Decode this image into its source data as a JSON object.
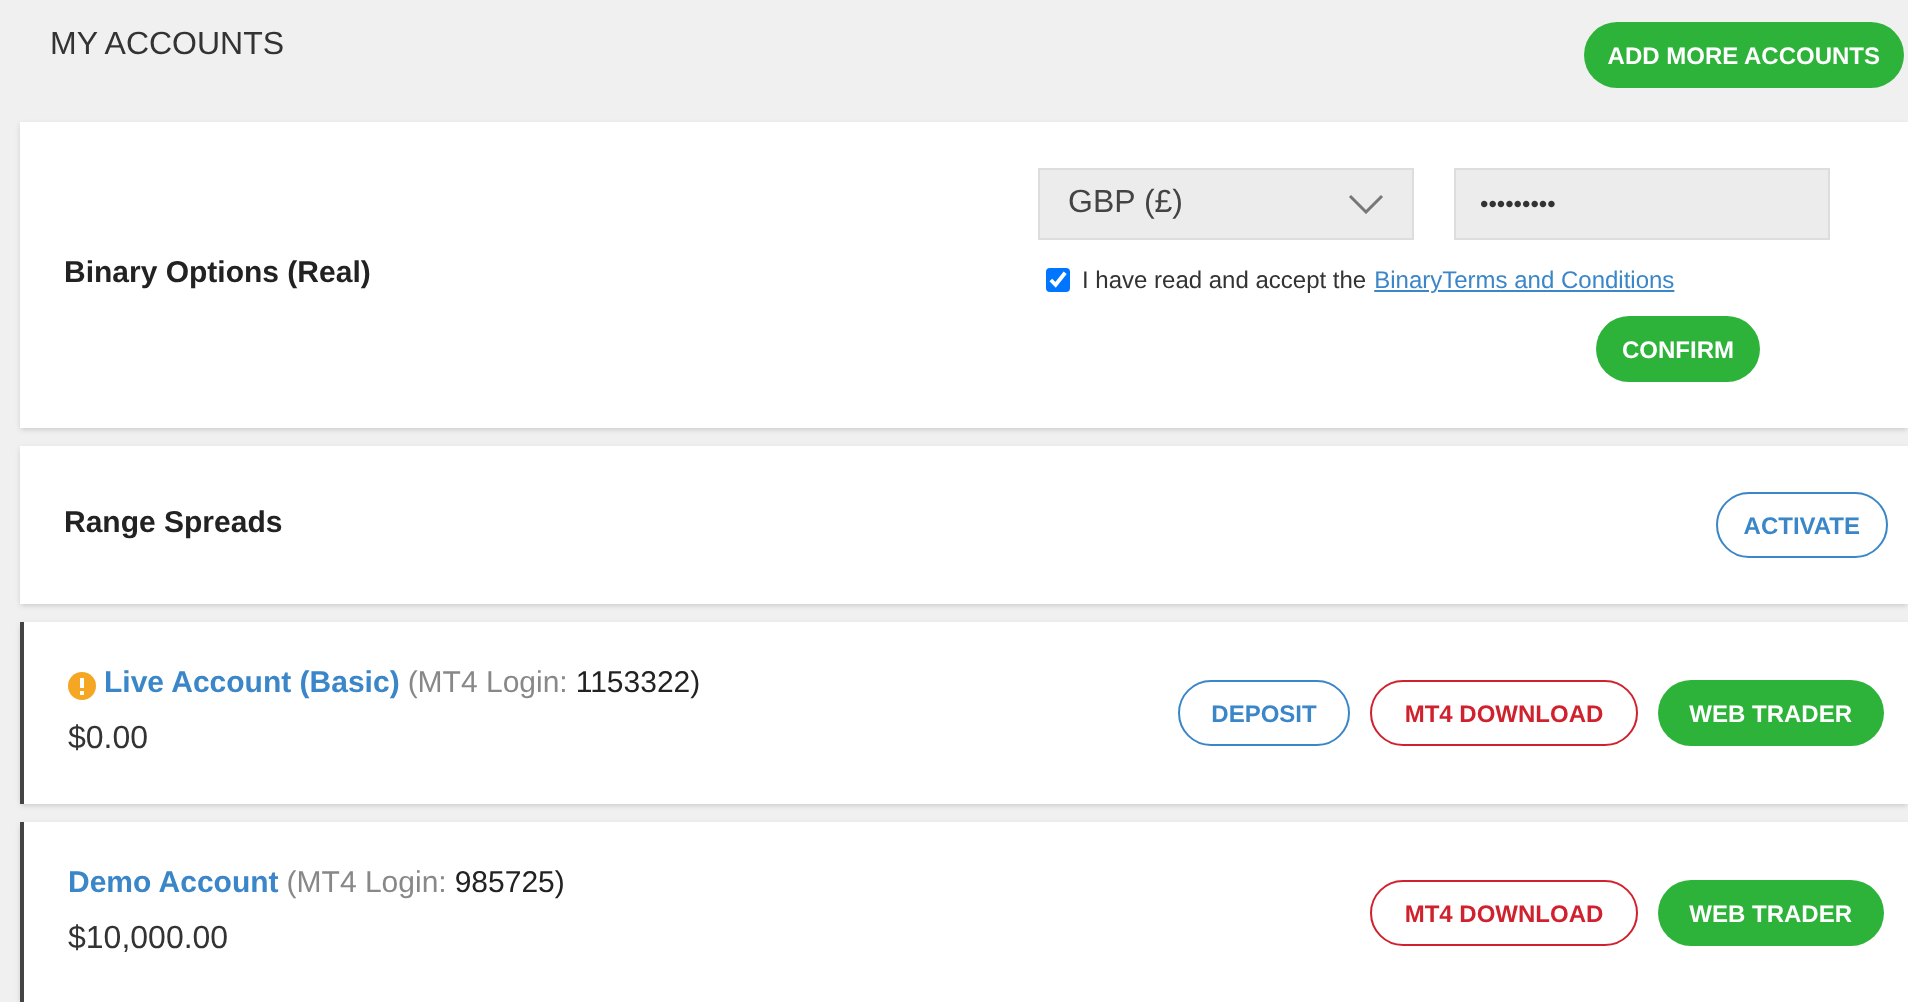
{
  "header": {
    "title": "MY ACCOUNTS",
    "button": "ADD MORE ACCOUNTS"
  },
  "new_account": {
    "name": "Binary Options (Real)",
    "currency": "GBP (£)",
    "password": "•••••••••",
    "terms": {
      "checked": true,
      "text": "I have read and accept the",
      "link": "BinaryTerms and Conditions"
    },
    "button": "CONFIRM"
  },
  "activate": {
    "name": "Range Spreads",
    "button": "ACTIVATE"
  },
  "accounts": [
    {
      "title": "Live Account (Basic)",
      "warning": true,
      "login_label": "(MT4 Login:",
      "login_id": "1153322)",
      "balance": "$0.00",
      "buttons": [
        {
          "kind": "outline-blue",
          "label": "DEPOSIT"
        },
        {
          "kind": "outline-red",
          "label": "MT4 DOWNLOAD"
        },
        {
          "kind": "solid-green",
          "label": "WEB TRADER"
        }
      ]
    },
    {
      "title": "Demo Account",
      "warning": false,
      "login_label": "(MT4 Login:",
      "login_id": "985725)",
      "balance": "$10,000.00",
      "buttons": [
        {
          "kind": "outline-red",
          "label": "MT4 DOWNLOAD"
        },
        {
          "kind": "solid-green",
          "label": "WEB TRADER"
        }
      ]
    }
  ]
}
